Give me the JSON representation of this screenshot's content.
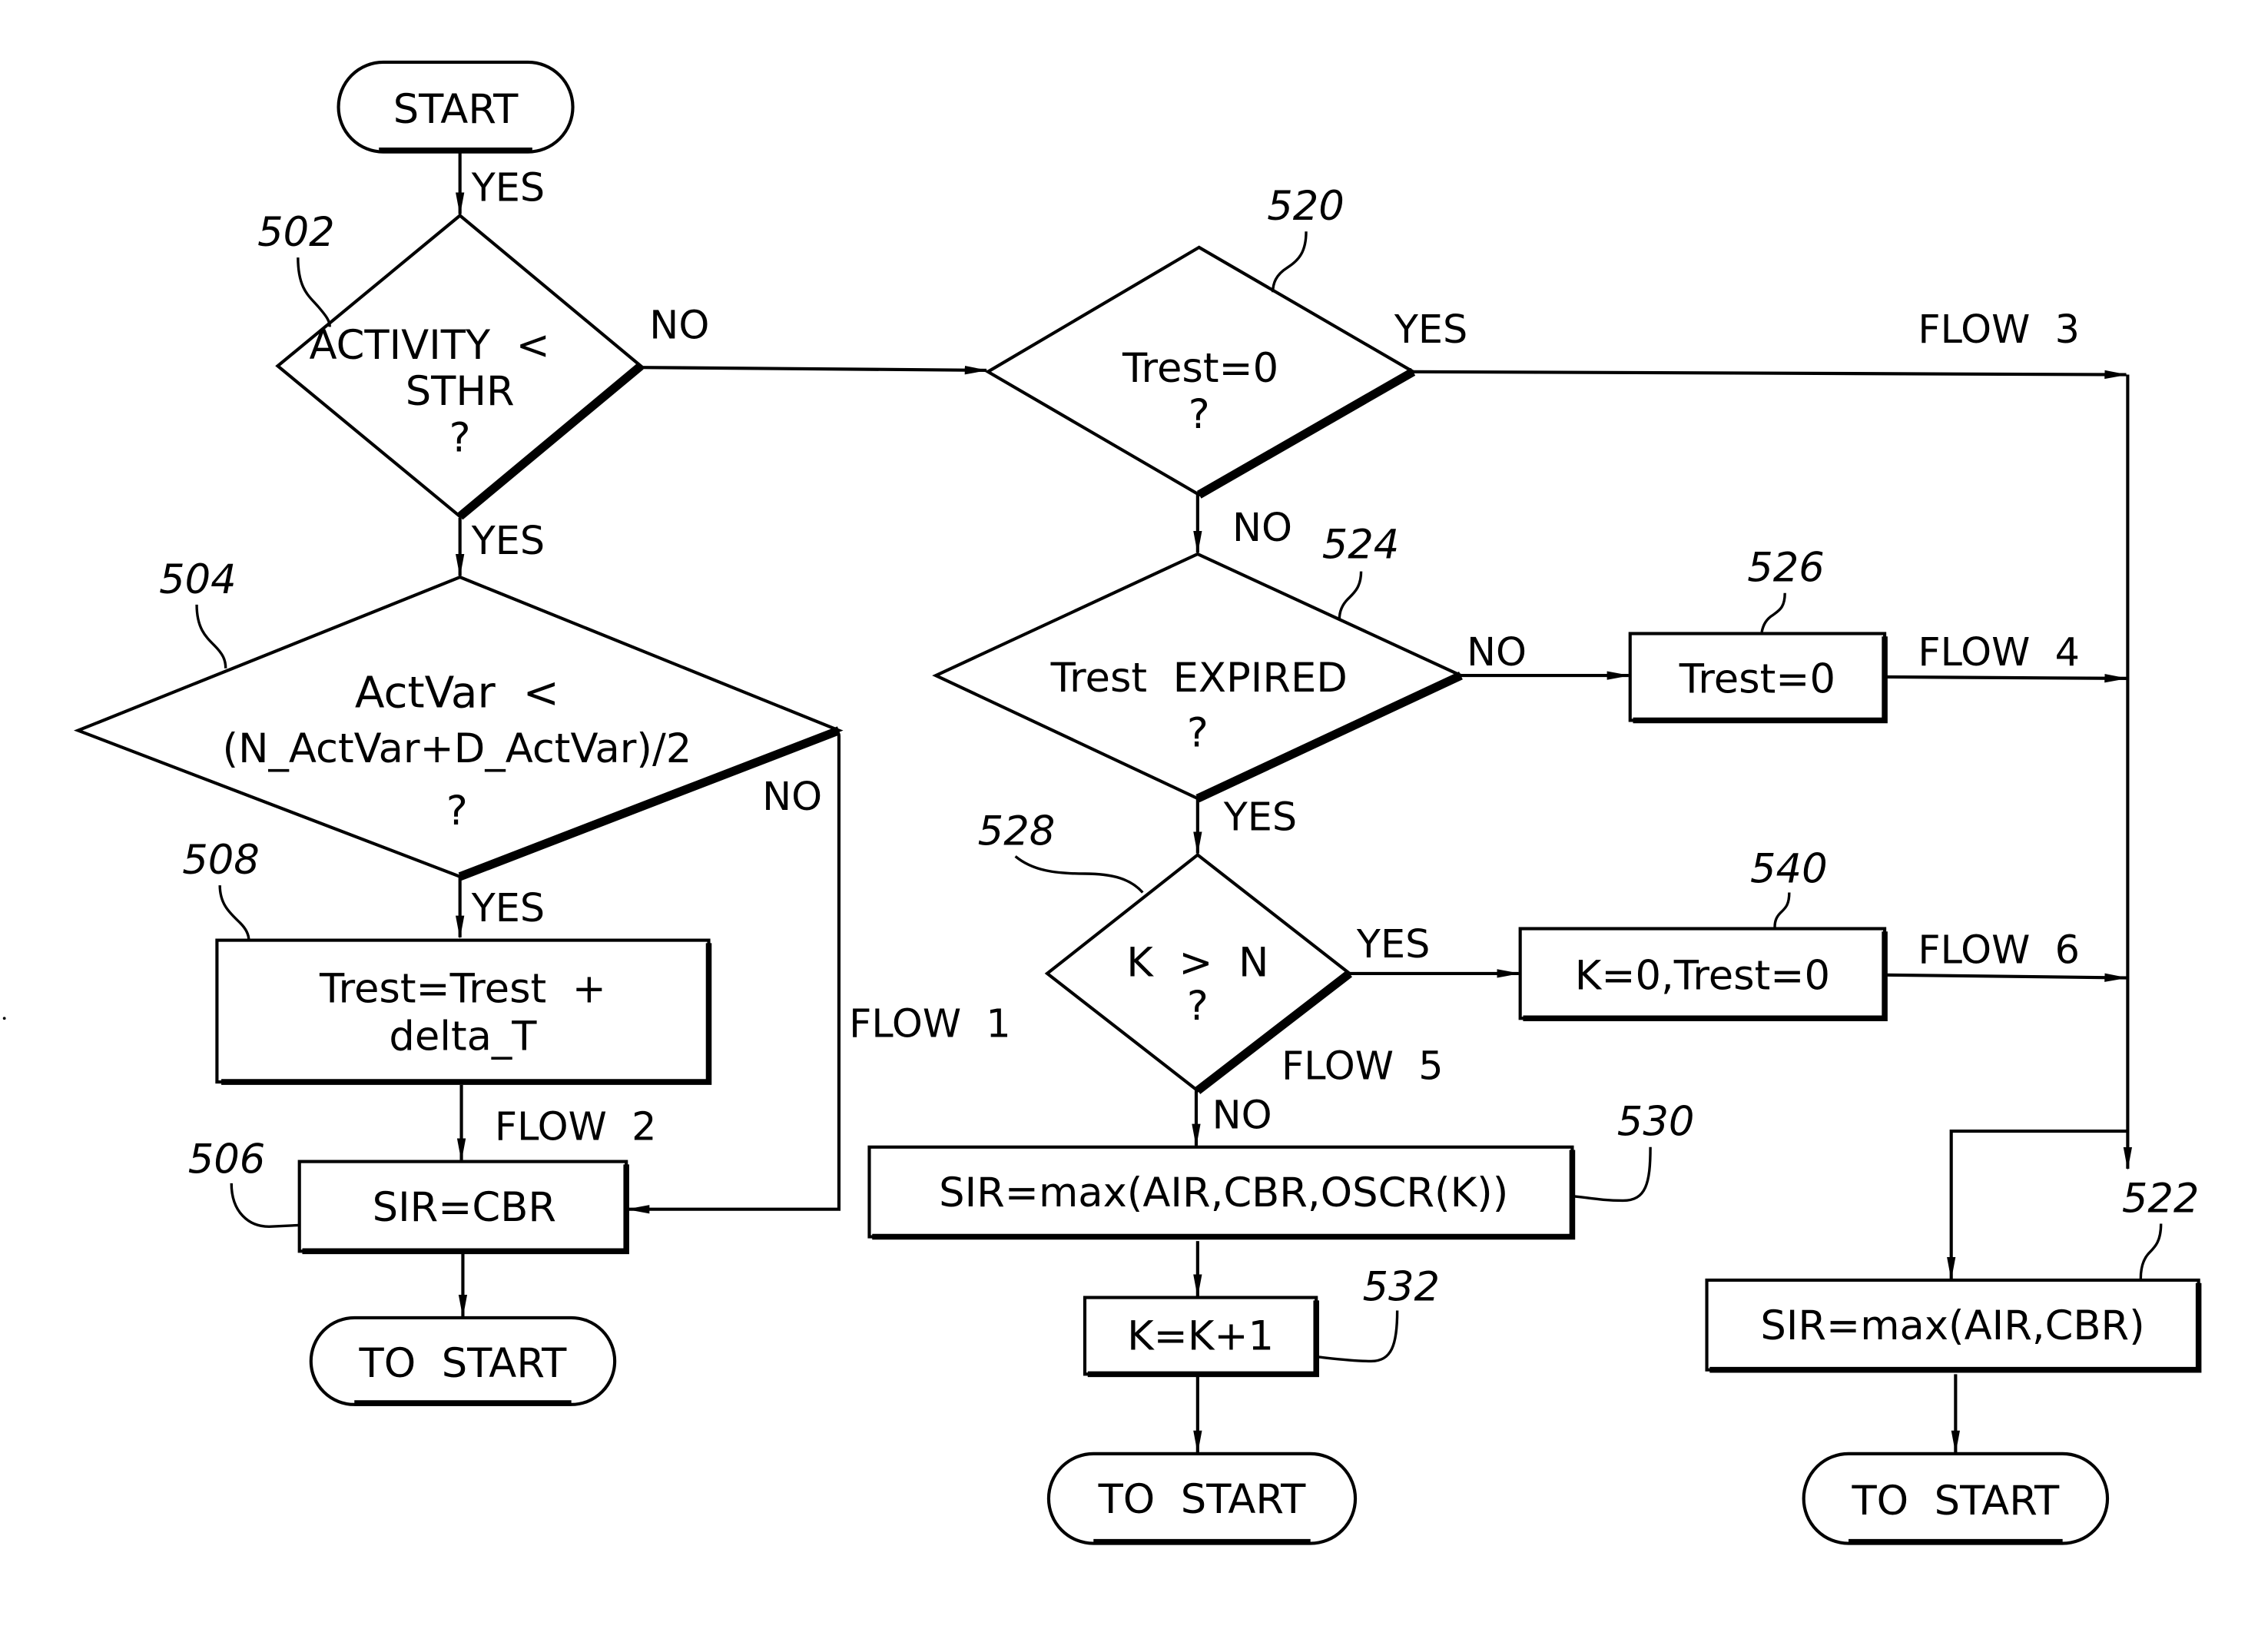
{
  "diagram": {
    "type": "flowchart",
    "nodes": {
      "start": {
        "text": [
          "START"
        ],
        "shape": "terminal"
      },
      "n502": {
        "ref": "502",
        "shape": "decision",
        "text": [
          "ACTIVITY  <",
          "STHR",
          "?"
        ]
      },
      "n504": {
        "ref": "504",
        "shape": "decision",
        "text": [
          "ActVar  <",
          "(N_ActVar+D_ActVar)/2",
          "?"
        ]
      },
      "n508": {
        "ref": "508",
        "shape": "process",
        "text": [
          "Trest=Trest  +",
          "delta_T"
        ]
      },
      "n506": {
        "ref": "506",
        "shape": "process",
        "text": [
          "SIR=CBR"
        ]
      },
      "end_left": {
        "text": [
          "TO  START"
        ],
        "shape": "terminal"
      },
      "n520": {
        "ref": "520",
        "shape": "decision",
        "text": [
          "Trest=0",
          "?"
        ]
      },
      "n524": {
        "ref": "524",
        "shape": "decision",
        "text": [
          "Trest  EXPIRED",
          "?"
        ]
      },
      "n526": {
        "ref": "526",
        "shape": "process",
        "text": [
          "Trest=0"
        ]
      },
      "n528": {
        "ref": "528",
        "shape": "decision",
        "text": [
          "K  >  N",
          "?"
        ]
      },
      "n540": {
        "ref": "540",
        "shape": "process",
        "text": [
          "K=0,Trest=0"
        ]
      },
      "n530": {
        "ref": "530",
        "shape": "process",
        "text": [
          "SIR=max(AIR,CBR,OSCR(K))"
        ]
      },
      "n532": {
        "ref": "532",
        "shape": "process",
        "text": [
          "K=K+1"
        ]
      },
      "end_mid": {
        "text": [
          "TO  START"
        ],
        "shape": "terminal"
      },
      "n522": {
        "ref": "522",
        "shape": "process",
        "text": [
          "SIR=max(AIR,CBR)"
        ]
      },
      "end_right": {
        "text": [
          "TO  START"
        ],
        "shape": "terminal"
      }
    },
    "edge_labels": {
      "start_502": "YES",
      "502_no": "NO",
      "502_yes": "YES",
      "504_no": "NO",
      "504_yes": "YES",
      "flow1": "FLOW  1",
      "flow2": "FLOW  2",
      "520_yes": "YES",
      "520_no": "NO",
      "524_no": "NO",
      "524_yes": "YES",
      "528_yes": "YES",
      "528_no": "NO",
      "flow3": "FLOW  3",
      "flow4": "FLOW  4",
      "flow5": "FLOW  5",
      "flow6": "FLOW  6"
    },
    "edges": [
      [
        "start",
        "n502",
        "YES"
      ],
      [
        "n502",
        "n504",
        "YES"
      ],
      [
        "n502",
        "n520",
        "NO"
      ],
      [
        "n504",
        "n508",
        "YES"
      ],
      [
        "n504",
        "n506",
        "NO / FLOW 1"
      ],
      [
        "n508",
        "n506",
        "FLOW 2"
      ],
      [
        "n506",
        "end_left",
        ""
      ],
      [
        "n520",
        "n522",
        "YES / FLOW 3"
      ],
      [
        "n520",
        "n524",
        "NO"
      ],
      [
        "n524",
        "n526",
        "NO"
      ],
      [
        "n526",
        "n522",
        "FLOW 4"
      ],
      [
        "n524",
        "n528",
        "YES"
      ],
      [
        "n528",
        "n540",
        "YES"
      ],
      [
        "n540",
        "n522",
        "FLOW 6"
      ],
      [
        "n528",
        "n530",
        "NO / FLOW 5"
      ],
      [
        "n530",
        "n532",
        ""
      ],
      [
        "n532",
        "end_mid",
        ""
      ],
      [
        "n522",
        "end_right",
        ""
      ]
    ]
  }
}
